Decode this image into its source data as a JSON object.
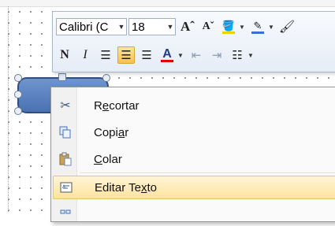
{
  "mini_toolbar": {
    "font_name": "Calibri (C",
    "font_size": "18",
    "buttons": [
      {
        "name": "grow-font",
        "glyph": "Aˆ"
      },
      {
        "name": "shrink-font",
        "glyph": "Aˇ"
      },
      {
        "name": "fill-color",
        "glyph": "⛽"
      },
      {
        "name": "line-color",
        "glyph": "✎"
      },
      {
        "name": "format-painter",
        "glyph": "✒"
      }
    ],
    "row2": {
      "bold": "N",
      "italic": "I",
      "font_color_glyph": "A"
    }
  },
  "context_menu": {
    "items": [
      {
        "label_pre": "R",
        "label_u": "e",
        "label_post": "cortar",
        "icon": "scissors-icon"
      },
      {
        "label_pre": "Copi",
        "label_u": "a",
        "label_post": "r",
        "icon": "copy-icon"
      },
      {
        "label_pre": "",
        "label_u": "C",
        "label_post": "olar",
        "icon": "paste-icon"
      },
      {
        "label_pre": "Editar Te",
        "label_u": "x",
        "label_post": "to",
        "icon": "edit-text-icon"
      }
    ]
  },
  "colors": {
    "accent_highlight": "#fde39c",
    "shape_fill": "#5b84c4",
    "font_color_bar": "#e00000",
    "fill_color_bar": "#f0d000",
    "line_color_bar": "#3a6fcf"
  }
}
